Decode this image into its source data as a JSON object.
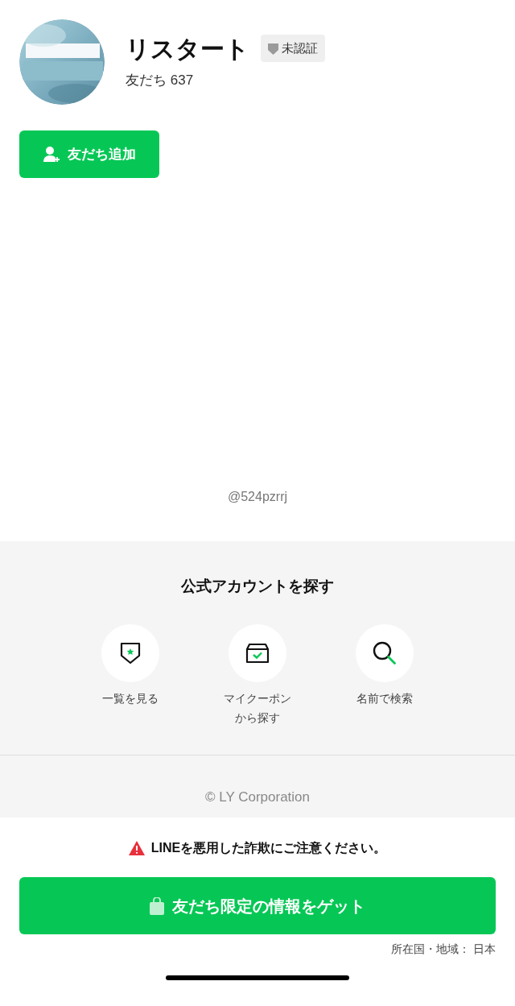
{
  "profile": {
    "name": "リスタート",
    "badge": "未認証",
    "friends": "友だち 637",
    "add_button": "友だち追加",
    "handle": "@524pzrrj"
  },
  "explore": {
    "title": "公式アカウントを探す",
    "items": [
      {
        "kind": "list",
        "label": "一覧を見る"
      },
      {
        "kind": "coupon",
        "label": "マイクーポンから探す"
      },
      {
        "kind": "search",
        "label": "名前で検索"
      }
    ],
    "copyright": "© LY Corporation"
  },
  "footer": {
    "warning": "LINEを悪用した詐欺にご注意ください。",
    "cta": "友だち限定の情報をゲット",
    "region": "所在国・地域： 日本"
  }
}
